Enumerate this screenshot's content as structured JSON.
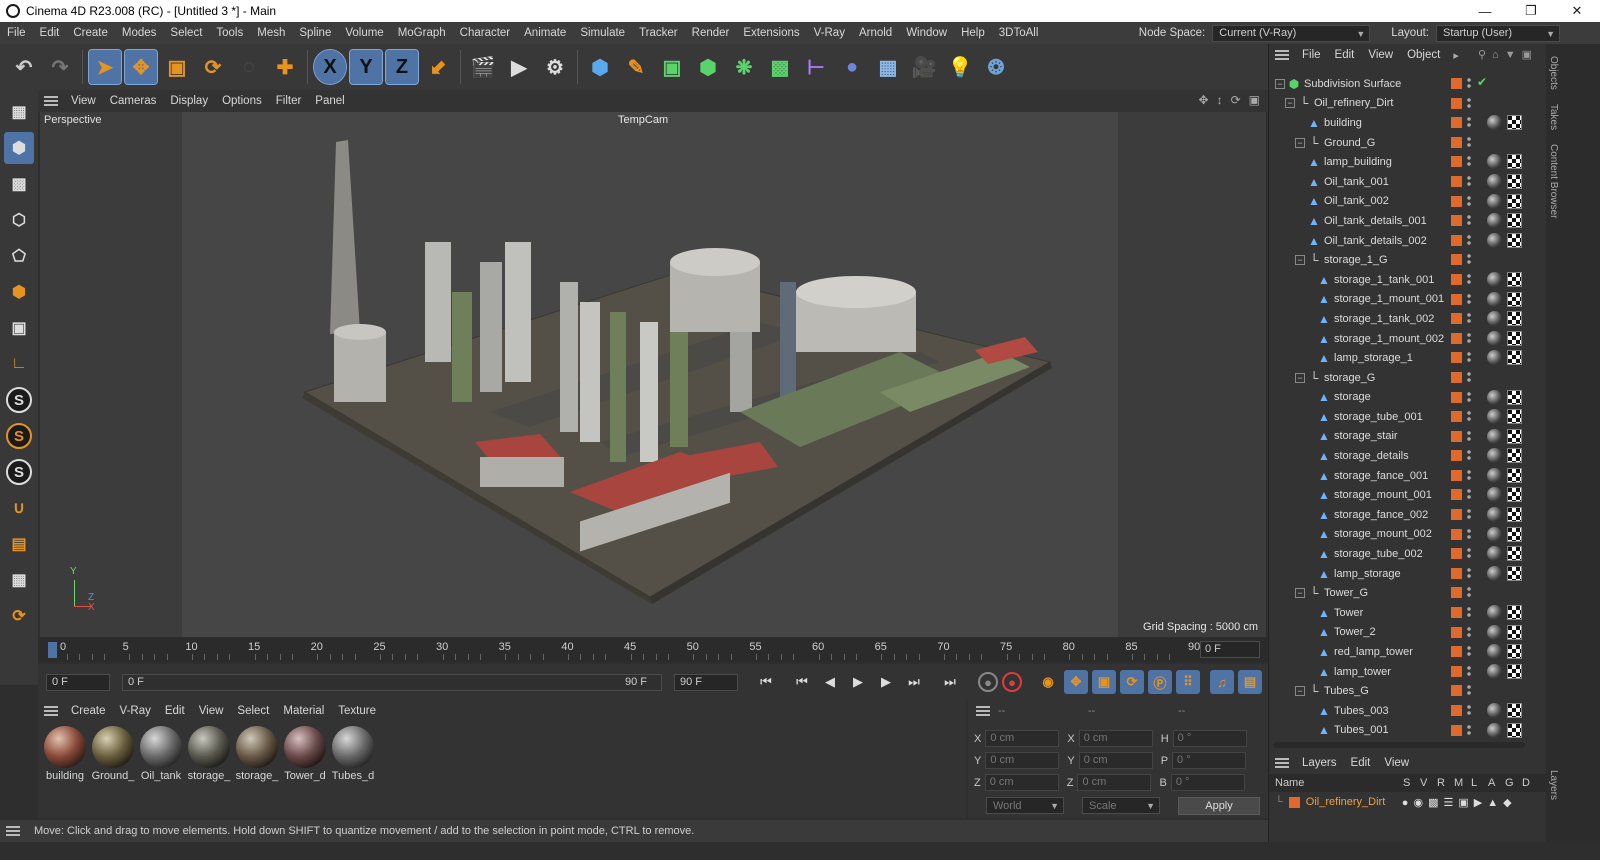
{
  "window": {
    "title": "Cinema 4D R23.008 (RC) - [Untitled 3 *] - Main"
  },
  "menu": {
    "items": [
      "File",
      "Edit",
      "Create",
      "Modes",
      "Select",
      "Tools",
      "Mesh",
      "Spline",
      "Volume",
      "MoGraph",
      "Character",
      "Animate",
      "Simulate",
      "Tracker",
      "Render",
      "Extensions",
      "V-Ray",
      "Arnold",
      "Window",
      "Help",
      "3DToAll"
    ],
    "node_space_label": "Node Space:",
    "node_space_value": "Current (V-Ray)",
    "layout_label": "Layout:",
    "layout_value": "Startup (User)"
  },
  "toolbar": {
    "x": "X",
    "y": "Y",
    "z": "Z"
  },
  "viewport": {
    "menu": [
      "View",
      "Cameras",
      "Display",
      "Options",
      "Filter",
      "Panel"
    ],
    "label": "Perspective",
    "camera": "TempCam",
    "grid_spacing": "Grid Spacing : 5000 cm",
    "axis_y": "Y",
    "axis_z": "Z",
    "axis_x": "X"
  },
  "timeline": {
    "ticks": [
      "0",
      "5",
      "10",
      "15",
      "20",
      "25",
      "30",
      "35",
      "40",
      "45",
      "50",
      "55",
      "60",
      "65",
      "70",
      "75",
      "80",
      "85",
      "90"
    ],
    "end_field": "0 F"
  },
  "playback": {
    "start": "0 F",
    "range_start": "0 F",
    "range_end": "90 F",
    "end": "90 F"
  },
  "materials": {
    "menu": [
      "Create",
      "V-Ray",
      "Edit",
      "View",
      "Select",
      "Material",
      "Texture"
    ],
    "items": [
      "building",
      "Ground_",
      "Oil_tank",
      "storage_",
      "storage_",
      "Tower_d",
      "Tubes_d"
    ]
  },
  "coords": {
    "head": [
      "--",
      "--",
      "--"
    ],
    "x": "X",
    "y": "Y",
    "z": "Z",
    "h": "H",
    "p": "P",
    "b": "B",
    "pos": "0 cm",
    "rot": "0 °",
    "world": "World",
    "scale": "Scale",
    "apply": "Apply"
  },
  "status": {
    "text": "Move: Click and drag to move elements. Hold down SHIFT to quantize movement / add to the selection in point mode, CTRL to remove."
  },
  "objects": {
    "menu": [
      "File",
      "Edit",
      "View",
      "Object"
    ],
    "rows": [
      {
        "name": "Subdivision Surface",
        "level": 0,
        "icon": "subdiv"
      },
      {
        "name": "Oil_refinery_Dirt",
        "level": 1,
        "icon": "null"
      },
      {
        "name": "building",
        "level": 2,
        "icon": "poly"
      },
      {
        "name": "Ground_G",
        "level": 2,
        "icon": "null"
      },
      {
        "name": "lamp_building",
        "level": 2,
        "icon": "poly"
      },
      {
        "name": "Oil_tank_001",
        "level": 2,
        "icon": "poly"
      },
      {
        "name": "Oil_tank_002",
        "level": 2,
        "icon": "poly"
      },
      {
        "name": "Oil_tank_details_001",
        "level": 2,
        "icon": "poly"
      },
      {
        "name": "Oil_tank_details_002",
        "level": 2,
        "icon": "poly"
      },
      {
        "name": "storage_1_G",
        "level": 2,
        "icon": "null"
      },
      {
        "name": "storage_1_tank_001",
        "level": 3,
        "icon": "poly"
      },
      {
        "name": "storage_1_mount_001",
        "level": 3,
        "icon": "poly"
      },
      {
        "name": "storage_1_tank_002",
        "level": 3,
        "icon": "poly"
      },
      {
        "name": "storage_1_mount_002",
        "level": 3,
        "icon": "poly"
      },
      {
        "name": "lamp_storage_1",
        "level": 3,
        "icon": "poly"
      },
      {
        "name": "storage_G",
        "level": 2,
        "icon": "null"
      },
      {
        "name": "storage",
        "level": 3,
        "icon": "poly"
      },
      {
        "name": "storage_tube_001",
        "level": 3,
        "icon": "poly"
      },
      {
        "name": "storage_stair",
        "level": 3,
        "icon": "poly"
      },
      {
        "name": "storage_details",
        "level": 3,
        "icon": "poly"
      },
      {
        "name": "storage_fance_001",
        "level": 3,
        "icon": "poly"
      },
      {
        "name": "storage_mount_001",
        "level": 3,
        "icon": "poly"
      },
      {
        "name": "storage_fance_002",
        "level": 3,
        "icon": "poly"
      },
      {
        "name": "storage_mount_002",
        "level": 3,
        "icon": "poly"
      },
      {
        "name": "storage_tube_002",
        "level": 3,
        "icon": "poly"
      },
      {
        "name": "lamp_storage",
        "level": 3,
        "icon": "poly"
      },
      {
        "name": "Tower_G",
        "level": 2,
        "icon": "null"
      },
      {
        "name": "Tower",
        "level": 3,
        "icon": "poly"
      },
      {
        "name": "Tower_2",
        "level": 3,
        "icon": "poly"
      },
      {
        "name": "red_lamp_tower",
        "level": 3,
        "icon": "poly"
      },
      {
        "name": "lamp_tower",
        "level": 3,
        "icon": "poly"
      },
      {
        "name": "Tubes_G",
        "level": 2,
        "icon": "null"
      },
      {
        "name": "Tubes_003",
        "level": 3,
        "icon": "poly"
      },
      {
        "name": "Tubes_001",
        "level": 3,
        "icon": "poly"
      }
    ]
  },
  "layers": {
    "menu": [
      "Layers",
      "Edit",
      "View"
    ],
    "col_name": "Name",
    "cols": [
      "S",
      "V",
      "R",
      "M",
      "L",
      "A",
      "G",
      "D"
    ],
    "row": "Oil_refinery_Dirt"
  },
  "side_tabs": {
    "objects": "Objects",
    "takes": "Takes",
    "content": "Content Browser",
    "layers": "Layers"
  },
  "colors": {
    "accent": "#4f73a5",
    "layer_color": "#e0692c",
    "key": "#e69320"
  }
}
